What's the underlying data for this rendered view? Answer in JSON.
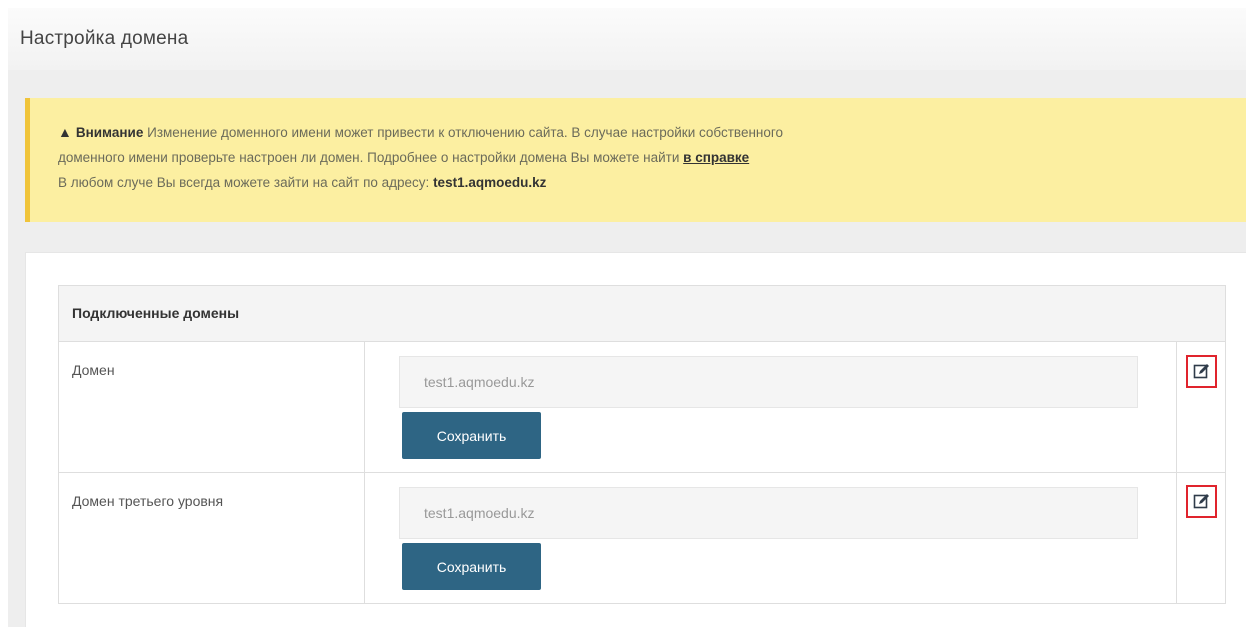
{
  "page": {
    "title": "Настройка домена"
  },
  "alert": {
    "icon": "warning-triangle-icon",
    "strong": "Внимание",
    "line1": "Изменение доменного имени может привести к отключению сайта. В случае настройки собственного",
    "line2_prefix": "доменного имени проверьте настроен ли домен. Подробнее о настройки домена Вы можете найти",
    "link": "в справке",
    "line3_prefix": "В любом случе Вы всегда можете зайти на сайт по адресу:",
    "address": "test1.aqmoedu.kz",
    "colors": {
      "background": "#fcefa1",
      "border": "#f0c43a"
    }
  },
  "table": {
    "header": "Подключенные домены",
    "rows": [
      {
        "label": "Домен",
        "value": "test1.aqmoedu.kz",
        "save_label": "Сохранить",
        "edit_icon": "edit-icon"
      },
      {
        "label": "Домен третьего уровня",
        "value": "test1.aqmoedu.kz",
        "save_label": "Сохранить",
        "edit_icon": "edit-icon"
      }
    ]
  },
  "colors": {
    "primary_button": "#2e6584",
    "edit_highlight": "#e0242d"
  }
}
